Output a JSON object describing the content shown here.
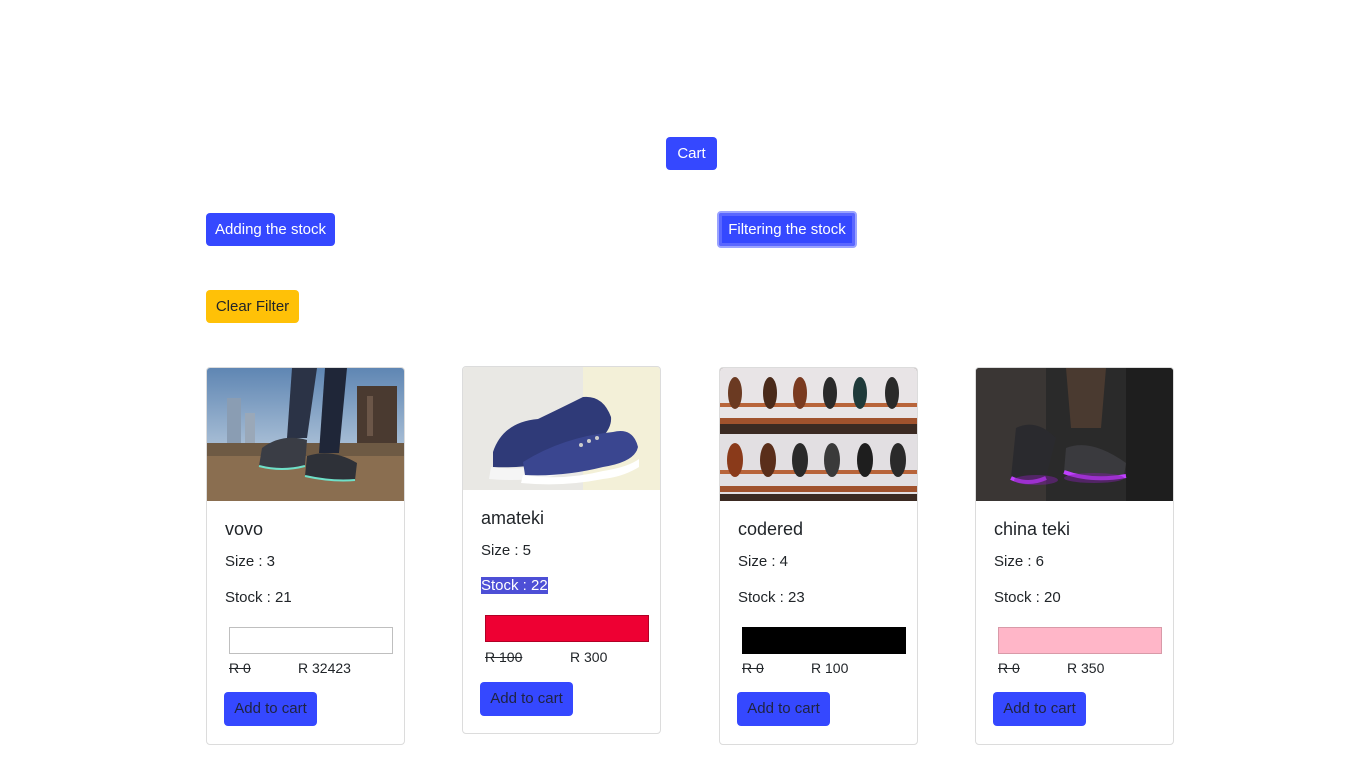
{
  "header": {
    "cart_label": "Cart",
    "add_stock_label": "Adding the stock",
    "filter_stock_label": "Filtering the stock",
    "clear_filter_label": "Clear Filter"
  },
  "colors": {
    "primary": "#3548ff",
    "warning": "#ffc107"
  },
  "products": [
    {
      "name": "vovo",
      "size": "Size : 3",
      "stock": "Stock : 21",
      "swatch_color": "#ffffff",
      "old_price": "R 0",
      "price": "R 32423",
      "button": "Add to cart"
    },
    {
      "name": "amateki",
      "size": "Size : 5",
      "stock": "Stock : 22",
      "swatch_color": "#ee0033",
      "old_price": "R 100",
      "price": "R 300",
      "button": "Add to cart"
    },
    {
      "name": "codered",
      "size": "Size : 4",
      "stock": "Stock : 23",
      "swatch_color": "#000000",
      "old_price": "R 0",
      "price": "R 100",
      "button": "Add to cart"
    },
    {
      "name": "china teki",
      "size": "Size : 6",
      "stock": "Stock : 20",
      "swatch_color": "#ffb6c8",
      "old_price": "R 0",
      "price": "R 350",
      "button": "Add to cart"
    }
  ]
}
